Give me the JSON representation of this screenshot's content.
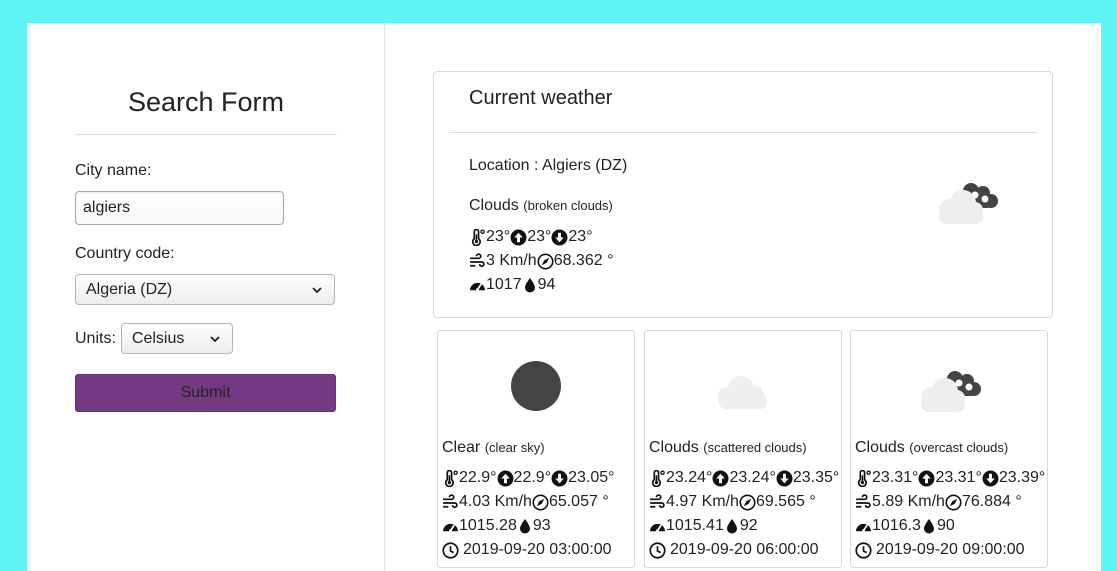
{
  "search_form": {
    "title": "Search Form",
    "city_label": "City name:",
    "city_value": "algiers",
    "country_label": "Country code:",
    "country_value": "Algeria (DZ)",
    "units_label": "Units:",
    "units_value": "Celsius",
    "submit_label": "Submit",
    "submit_color": "#753a85"
  },
  "current": {
    "title": "Current weather",
    "location": "Location : Algiers (DZ)",
    "condition": "Clouds",
    "description": "(broken clouds)",
    "temp": "23°",
    "temp_max": "23°",
    "temp_min": "23°",
    "wind_speed": "3 Km/h",
    "wind_deg": "68.362 °",
    "pressure": "1017",
    "humidity": "94",
    "icon": "broken-clouds-icon"
  },
  "forecast": [
    {
      "condition": "Clear",
      "description": "(clear sky)",
      "temp": "22.9°",
      "temp_max": "22.9°",
      "temp_min": "23.05°",
      "wind_speed": "4.03 Km/h",
      "wind_deg": "65.057 °",
      "pressure": "1015.28",
      "humidity": "93",
      "time": "2019-09-20 03:00:00",
      "icon": "clear-night-icon"
    },
    {
      "condition": "Clouds",
      "description": "(scattered clouds)",
      "temp": "23.24°",
      "temp_max": "23.24°",
      "temp_min": "23.35°",
      "wind_speed": "4.97 Km/h",
      "wind_deg": "69.565 °",
      "pressure": "1015.41",
      "humidity": "92",
      "time": "2019-09-20 06:00:00",
      "icon": "scattered-clouds-icon"
    },
    {
      "condition": "Clouds",
      "description": "(overcast clouds)",
      "temp": "23.31°",
      "temp_max": "23.31°",
      "temp_min": "23.39°",
      "wind_speed": "5.89 Km/h",
      "wind_deg": "76.884 °",
      "pressure": "1016.3",
      "humidity": "90",
      "time": "2019-09-20 09:00:00",
      "icon": "overcast-clouds-icon"
    }
  ],
  "colors": {
    "background": "#5ff3f6",
    "icon_dark": "#444444",
    "icon_light": "#eeeeee"
  }
}
